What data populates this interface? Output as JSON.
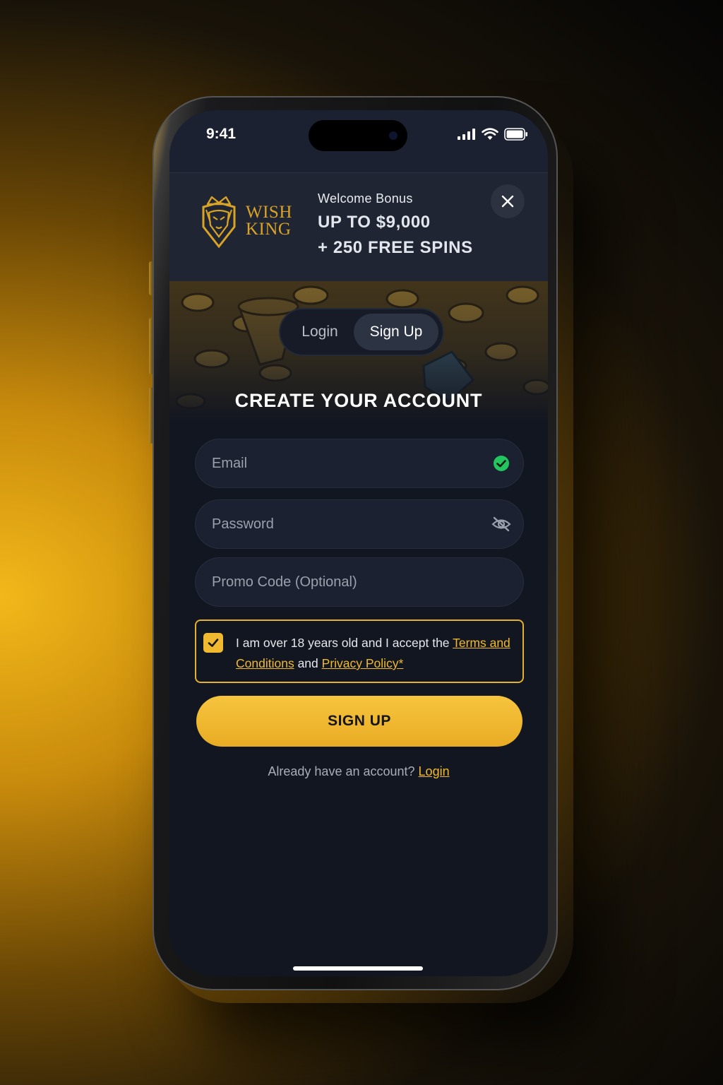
{
  "status_bar": {
    "time": "9:41",
    "icons": [
      "signal-icon",
      "wifi-icon",
      "battery-icon"
    ]
  },
  "banner": {
    "brand": {
      "line1": "WISH",
      "line2": "KING"
    },
    "welcome_label": "Welcome Bonus",
    "bonus_line1": "UP TO $9,000",
    "bonus_line2": "+ 250 FREE SPINS",
    "close_icon": "close-icon"
  },
  "tabs": [
    {
      "label": "Login",
      "active": false
    },
    {
      "label": "Sign Up",
      "active": true
    }
  ],
  "heading": "CREATE YOUR ACCOUNT",
  "form": {
    "email": {
      "placeholder": "Email",
      "status_icon": "check-circle-icon"
    },
    "password": {
      "placeholder": "Password",
      "toggle_icon": "eye-off-icon"
    },
    "promo": {
      "placeholder": "Promo Code (Optional)"
    }
  },
  "consent": {
    "checked": true,
    "text_before": "I am over 18 years old and I accept the ",
    "terms_link": "Terms and Conditions",
    "text_middle": " and ",
    "privacy_link": "Privacy Policy*"
  },
  "signup_button": "SIGN UP",
  "footer": {
    "prompt": "Already have an account? ",
    "login_link": "Login"
  },
  "colors": {
    "accent": "#F0B92F",
    "background": "#121620",
    "success": "#22C55E"
  }
}
